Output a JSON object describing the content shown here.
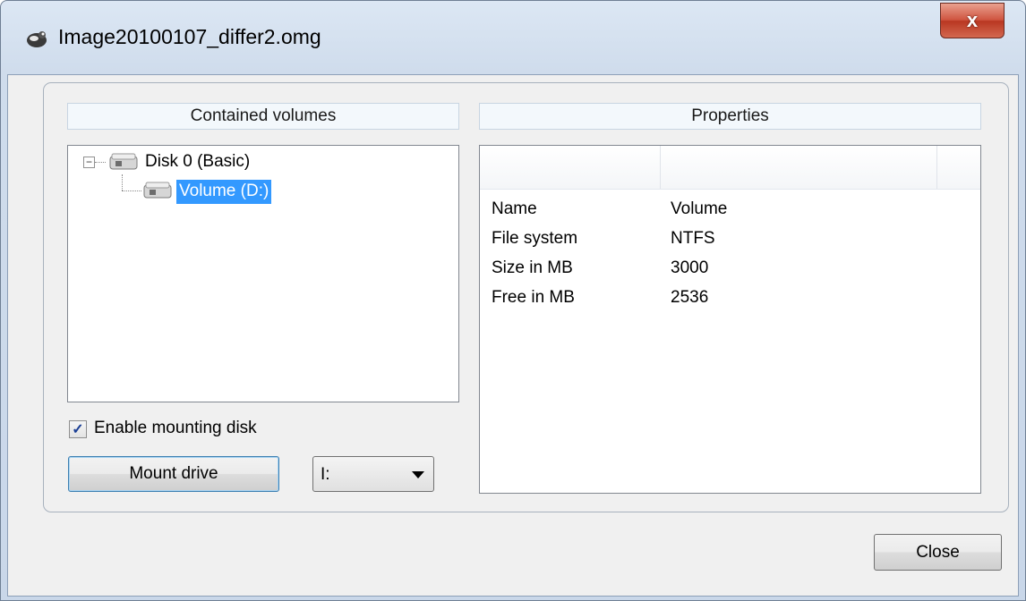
{
  "window": {
    "title": "Image20100107_differ2.omg",
    "close_glyph": "x",
    "app_icon": "app-logo-icon"
  },
  "contained_volumes": {
    "header": "Contained volumes",
    "tree": {
      "expander_glyph": "−",
      "disk": {
        "label": "Disk 0 (Basic)",
        "icon": "disk-icon"
      },
      "volume": {
        "label": "Volume (D:)",
        "icon": "volume-icon",
        "selected": true
      }
    },
    "enable_mounting": {
      "label": "Enable mounting disk",
      "checked": true,
      "check_glyph": "✓"
    },
    "mount_button": "Mount drive",
    "drive_select": {
      "value": "I:"
    }
  },
  "properties": {
    "header": "Properties",
    "rows": [
      {
        "name": "Name",
        "value": "Volume"
      },
      {
        "name": "File system",
        "value": "NTFS"
      },
      {
        "name": "Size in MB",
        "value": "3000"
      },
      {
        "name": "Free in MB",
        "value": "2536"
      }
    ]
  },
  "footer": {
    "close_button": "Close"
  },
  "colors": {
    "selection": "#3399ff",
    "close_button": "#c9452f"
  }
}
